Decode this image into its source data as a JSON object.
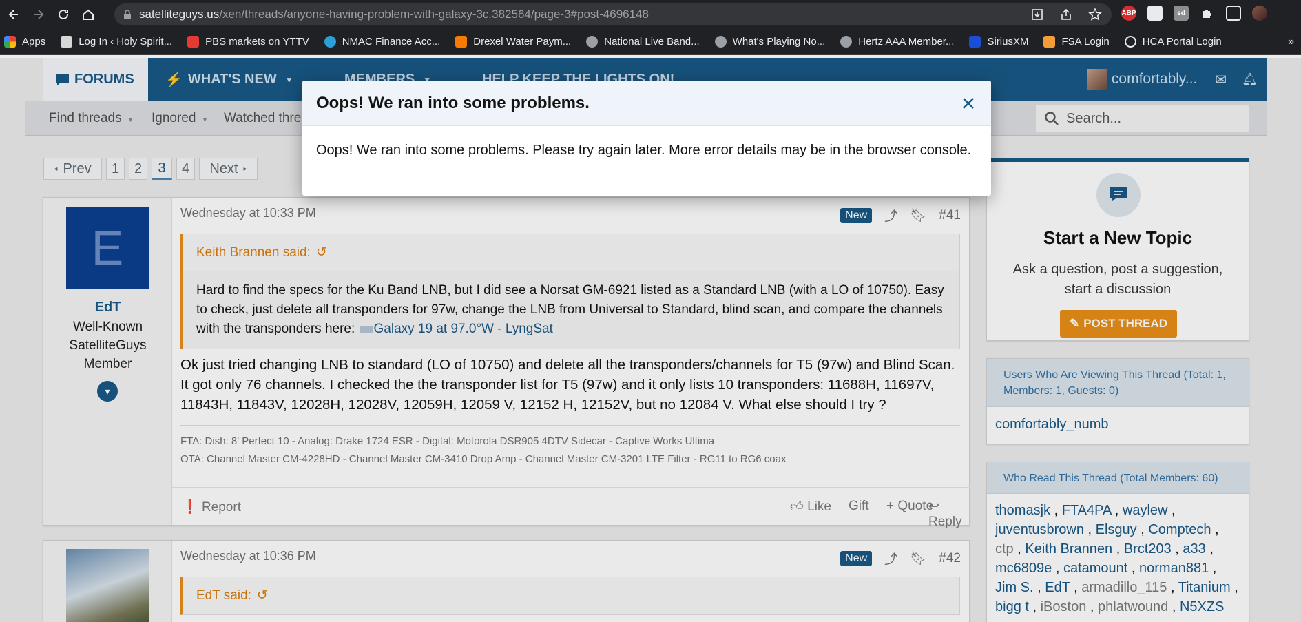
{
  "browser": {
    "url_host": "satelliteguys.us",
    "url_path": "/xen/threads/anyone-having-problem-with-galaxy-3c.382564/page-3#post-4696148",
    "extensions": [
      "ABP",
      "",
      "sd",
      "",
      "",
      ""
    ],
    "bookmarks": [
      {
        "label": "Apps",
        "color": "#ea4335"
      },
      {
        "label": "Log In ‹ Holy Spirit...",
        "color": "#d7d7d7"
      },
      {
        "label": "PBS markets on YTTV",
        "color": "#e53935"
      },
      {
        "label": "NMAC Finance Acc...",
        "color": "#2a9fd8"
      },
      {
        "label": "Drexel Water Paym...",
        "color": "#f57c00"
      },
      {
        "label": "National Live Band...",
        "color": "#9aa0a6"
      },
      {
        "label": "What's Playing No...",
        "color": "#9aa0a6"
      },
      {
        "label": "Hertz AAA Member...",
        "color": "#9aa0a6"
      },
      {
        "label": "SiriusXM",
        "color": "#1a4dd8"
      },
      {
        "label": "FSA Login",
        "color": "#f29d38"
      },
      {
        "label": "HCA Portal Login",
        "color": "#e8eaed"
      }
    ],
    "bookmarks_more": "»"
  },
  "nav": {
    "forums": "FORUMS",
    "whats_new": "WHAT'S NEW",
    "members": "MEMBERS",
    "keep_lights": "HELP KEEP THE LIGHTS ON!",
    "username": "comfortably..."
  },
  "subnav": {
    "find_threads": "Find threads",
    "ignored": "Ignored",
    "watched": "Watched threads",
    "search_placeholder": "Search..."
  },
  "pager": {
    "prev": "Prev",
    "pages": [
      "1",
      "2",
      "3",
      "4"
    ],
    "current": "3",
    "next": "Next"
  },
  "posts": [
    {
      "username": "EdT",
      "avatar_letter": "E",
      "title_lines": [
        "Well-Known",
        "SatelliteGuys",
        "Member"
      ],
      "date": "Wednesday at 10:33 PM",
      "badge": "New",
      "number": "#41",
      "quote_author": "Keith Brannen said:",
      "quote_text": "Hard to find the specs for the Ku Band LNB, but I did see a Norsat GM-6921 listed as a Standard LNB (with a LO of 10750). Easy to check, just delete all transponders for 97w, change the LNB from Universal to Standard, blind scan, and compare the channels with the transponders here:",
      "quote_link": "Galaxy 19 at 97.0°W - LyngSat",
      "text": "Ok just tried changing LNB to standard (LO of 10750) and delete all the transponders/channels for T5 (97w) and Blind Scan. It got only 76 channels. I checked the the transponder list for T5 (97w) and it only lists 10 transponders: 11688H, 11697V, 11843H, 11843V, 12028H, 12028V, 12059H, 12059 V, 12152 H, 12152V, but no 12084 V. What else should I try ?",
      "signature": [
        "FTA: Dish: 8' Perfect 10 - Analog: Drake 1724 ESR - Digital: Motorola DSR905 4DTV Sidecar - Captive Works Ultima",
        "OTA: Channel Master CM-4228HD - Channel Master CM-3410 Drop Amp - Channel Master CM-3201 LTE Filter - RG11 to RG6 coax"
      ],
      "actions": {
        "report": "Report",
        "like": "Like",
        "gift": "Gift",
        "quote": "Quote",
        "reply": "Reply"
      }
    },
    {
      "date": "Wednesday at 10:36 PM",
      "badge": "New",
      "number": "#42",
      "quote_author": "EdT said:"
    }
  ],
  "sidebar": {
    "start_topic_title": "Start a New Topic",
    "start_topic_sub": "Ask a question, post a suggestion, start a discussion",
    "post_thread": "POST THREAD",
    "viewers_head": "Users Who Are Viewing This Thread (Total: 1, Members: 1, Guests: 0)",
    "viewer": "comfortably_numb",
    "readers_head": "Who Read This Thread (Total Members: 60)",
    "readers": [
      {
        "name": "thomasjk",
        "muted": false
      },
      {
        "name": "FTA4PA",
        "muted": false
      },
      {
        "name": "waylew",
        "muted": false
      },
      {
        "name": "juventusbrown",
        "muted": false
      },
      {
        "name": "Elsguy",
        "muted": false
      },
      {
        "name": "Comptech",
        "muted": false
      },
      {
        "name": "ctp",
        "muted": true
      },
      {
        "name": "Keith Brannen",
        "muted": false
      },
      {
        "name": "Brct203",
        "muted": false
      },
      {
        "name": "a33",
        "muted": false
      },
      {
        "name": "mc6809e",
        "muted": false
      },
      {
        "name": "catamount",
        "muted": false
      },
      {
        "name": "norman881",
        "muted": false
      },
      {
        "name": "Jim S.",
        "muted": false
      },
      {
        "name": "EdT",
        "muted": false
      },
      {
        "name": "armadillo_115",
        "muted": true
      },
      {
        "name": "Titanium",
        "muted": false
      },
      {
        "name": "bigg t",
        "muted": false
      },
      {
        "name": "iBoston",
        "muted": true
      },
      {
        "name": "phlatwound",
        "muted": true
      },
      {
        "name": "N5XZS",
        "muted": false
      }
    ]
  },
  "modal": {
    "title": "Oops! We ran into some problems.",
    "message": "Oops! We ran into some problems. Please try again later. More error details may be in the browser console."
  }
}
